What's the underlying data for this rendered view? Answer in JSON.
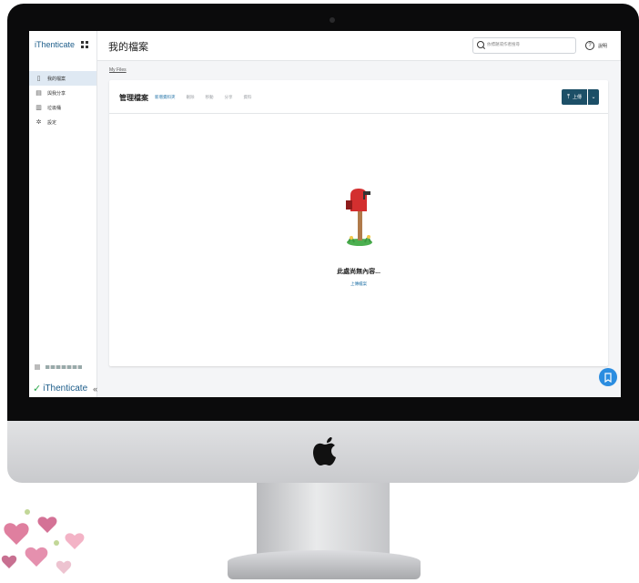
{
  "app": {
    "brand": "iThenticate",
    "footer_brand": "iThenticate",
    "collapse_symbol": "«"
  },
  "sidebar": {
    "items": [
      {
        "label": "我的檔案",
        "icon": "file-icon",
        "active": true
      },
      {
        "label": "與我分享",
        "icon": "shared-icon",
        "active": false
      },
      {
        "label": "垃圾桶",
        "icon": "trash-icon",
        "active": false
      },
      {
        "label": "設定",
        "icon": "gear-icon",
        "active": false
      }
    ]
  },
  "header": {
    "title": "我的檔案",
    "search_placeholder": "依標題或作者搜尋",
    "help_label": "說明"
  },
  "breadcrumb": "My Files",
  "card": {
    "title": "管理檔案",
    "actions": [
      {
        "label": "新增資料夾",
        "enabled": true
      },
      {
        "label": "刪除",
        "enabled": false
      },
      {
        "label": "移動",
        "enabled": false
      },
      {
        "label": "分享",
        "enabled": false
      },
      {
        "label": "資料",
        "enabled": false
      }
    ],
    "upload_label": "上傳",
    "empty_title": "此處尚無內容...",
    "empty_link": "上傳檔案"
  },
  "colors": {
    "accent": "#1d6fa5",
    "primary_button": "#1c4f67",
    "fab": "#2b8de0"
  }
}
